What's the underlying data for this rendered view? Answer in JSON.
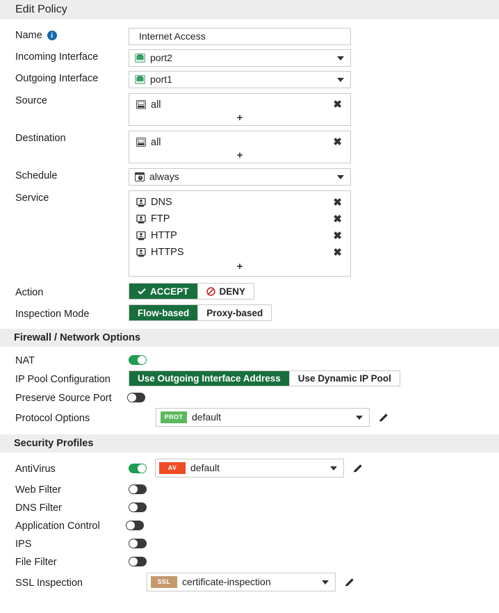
{
  "dialog": {
    "title": "Edit Policy"
  },
  "colors": {
    "header_bg": "#ededed",
    "accept_green": "#186f3d",
    "toggle_on_green": "#1f9d55",
    "toggle_off_gray": "#3a3a3a",
    "prot_badge": "#5cb85c",
    "av_badge": "#f04b23",
    "ssl_badge": "#c49a6c",
    "info_blue": "#1769b0",
    "deny_red": "#cc2222",
    "port_icon_green": "#3aa86b"
  },
  "form": {
    "name": {
      "label": "Name",
      "info_icon": "info-icon",
      "value": "Internet Access",
      "placeholder": "Name"
    },
    "incoming_interface": {
      "label": "Incoming Interface",
      "value": "port2",
      "icon": "network-port-icon"
    },
    "outgoing_interface": {
      "label": "Outgoing Interface",
      "value": "port1",
      "icon": "network-port-icon"
    },
    "source": {
      "label": "Source",
      "items": [
        {
          "name": "all",
          "icon": "address-object-icon"
        }
      ],
      "add_label": "+"
    },
    "destination": {
      "label": "Destination",
      "items": [
        {
          "name": "all",
          "icon": "address-object-icon"
        }
      ],
      "add_label": "+"
    },
    "schedule": {
      "label": "Schedule",
      "value": "always",
      "icon": "schedule-clock-icon"
    },
    "service": {
      "label": "Service",
      "items": [
        {
          "name": "DNS",
          "icon": "service-icon"
        },
        {
          "name": "FTP",
          "icon": "service-icon"
        },
        {
          "name": "HTTP",
          "icon": "service-icon"
        },
        {
          "name": "HTTPS",
          "icon": "service-icon"
        }
      ],
      "add_label": "+"
    },
    "action": {
      "label": "Action",
      "options": [
        {
          "label": "ACCEPT",
          "icon": "check-icon",
          "selected": true
        },
        {
          "label": "DENY",
          "icon": "deny-icon",
          "selected": false
        }
      ]
    },
    "inspection_mode": {
      "label": "Inspection Mode",
      "options": [
        {
          "label": "Flow-based",
          "selected": true
        },
        {
          "label": "Proxy-based",
          "selected": false
        }
      ]
    }
  },
  "firewall_section": {
    "title": "Firewall / Network Options",
    "nat": {
      "label": "NAT",
      "state": "on"
    },
    "ip_pool_configuration": {
      "label": "IP Pool Configuration",
      "options": [
        {
          "label": "Use Outgoing Interface Address",
          "selected": true
        },
        {
          "label": "Use Dynamic IP Pool",
          "selected": false
        }
      ]
    },
    "preserve_source_port": {
      "label": "Preserve Source Port",
      "state": "off"
    },
    "protocol_options": {
      "label": "Protocol Options",
      "badge": "PROT",
      "value": "default",
      "edit_icon": "pencil-icon"
    }
  },
  "security_section": {
    "title": "Security Profiles",
    "rows": [
      {
        "label": "AntiVirus",
        "state": "on",
        "badge": "AV",
        "value": "default",
        "edit_icon": "pencil-icon"
      },
      {
        "label": "Web Filter",
        "state": "off"
      },
      {
        "label": "DNS Filter",
        "state": "off"
      },
      {
        "label": "Application Control",
        "state": "off"
      },
      {
        "label": "IPS",
        "state": "off"
      },
      {
        "label": "File Filter",
        "state": "off"
      },
      {
        "label": "SSL Inspection",
        "state": "none",
        "badge": "SSL",
        "value": "certificate-inspection",
        "edit_icon": "pencil-icon"
      }
    ]
  }
}
